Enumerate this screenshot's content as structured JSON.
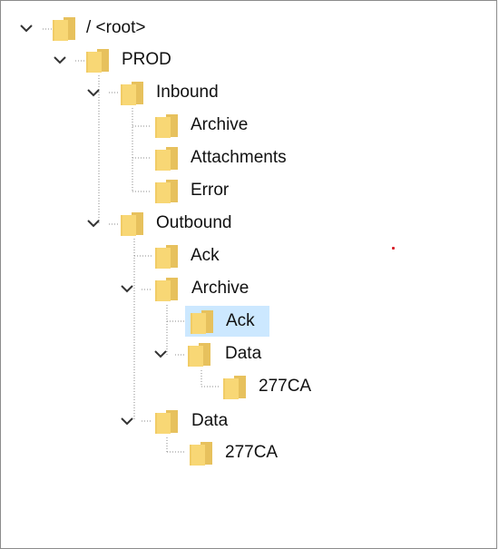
{
  "tree": {
    "root": {
      "label": "/ <root>",
      "expanded": true,
      "icon": "folder-icon"
    },
    "prod": {
      "label": "PROD",
      "expanded": true,
      "icon": "folder-icon"
    },
    "inbound": {
      "label": "Inbound",
      "expanded": true,
      "icon": "folder-icon",
      "children": [
        {
          "label": "Archive",
          "icon": "folder-icon"
        },
        {
          "label": "Attachments",
          "icon": "folder-icon"
        },
        {
          "label": "Error",
          "icon": "folder-icon"
        }
      ]
    },
    "outbound": {
      "label": "Outbound",
      "expanded": true,
      "icon": "folder-icon",
      "ack": {
        "label": "Ack",
        "icon": "folder-icon"
      },
      "archive": {
        "label": "Archive",
        "expanded": true,
        "icon": "folder-icon",
        "ack": {
          "label": "Ack",
          "selected": true,
          "icon": "folder-icon"
        },
        "data": {
          "label": "Data",
          "expanded": true,
          "icon": "folder-icon",
          "child": {
            "label": "277CA",
            "icon": "folder-icon"
          }
        }
      },
      "data": {
        "label": "Data",
        "expanded": true,
        "icon": "folder-icon",
        "child": {
          "label": "277CA",
          "icon": "folder-icon"
        }
      }
    }
  },
  "colors": {
    "folder_fill": "#f8d775",
    "folder_back": "#e7c15d",
    "selection": "#cce8ff",
    "border": "#8c8c8c",
    "marker": "#d8202a"
  }
}
